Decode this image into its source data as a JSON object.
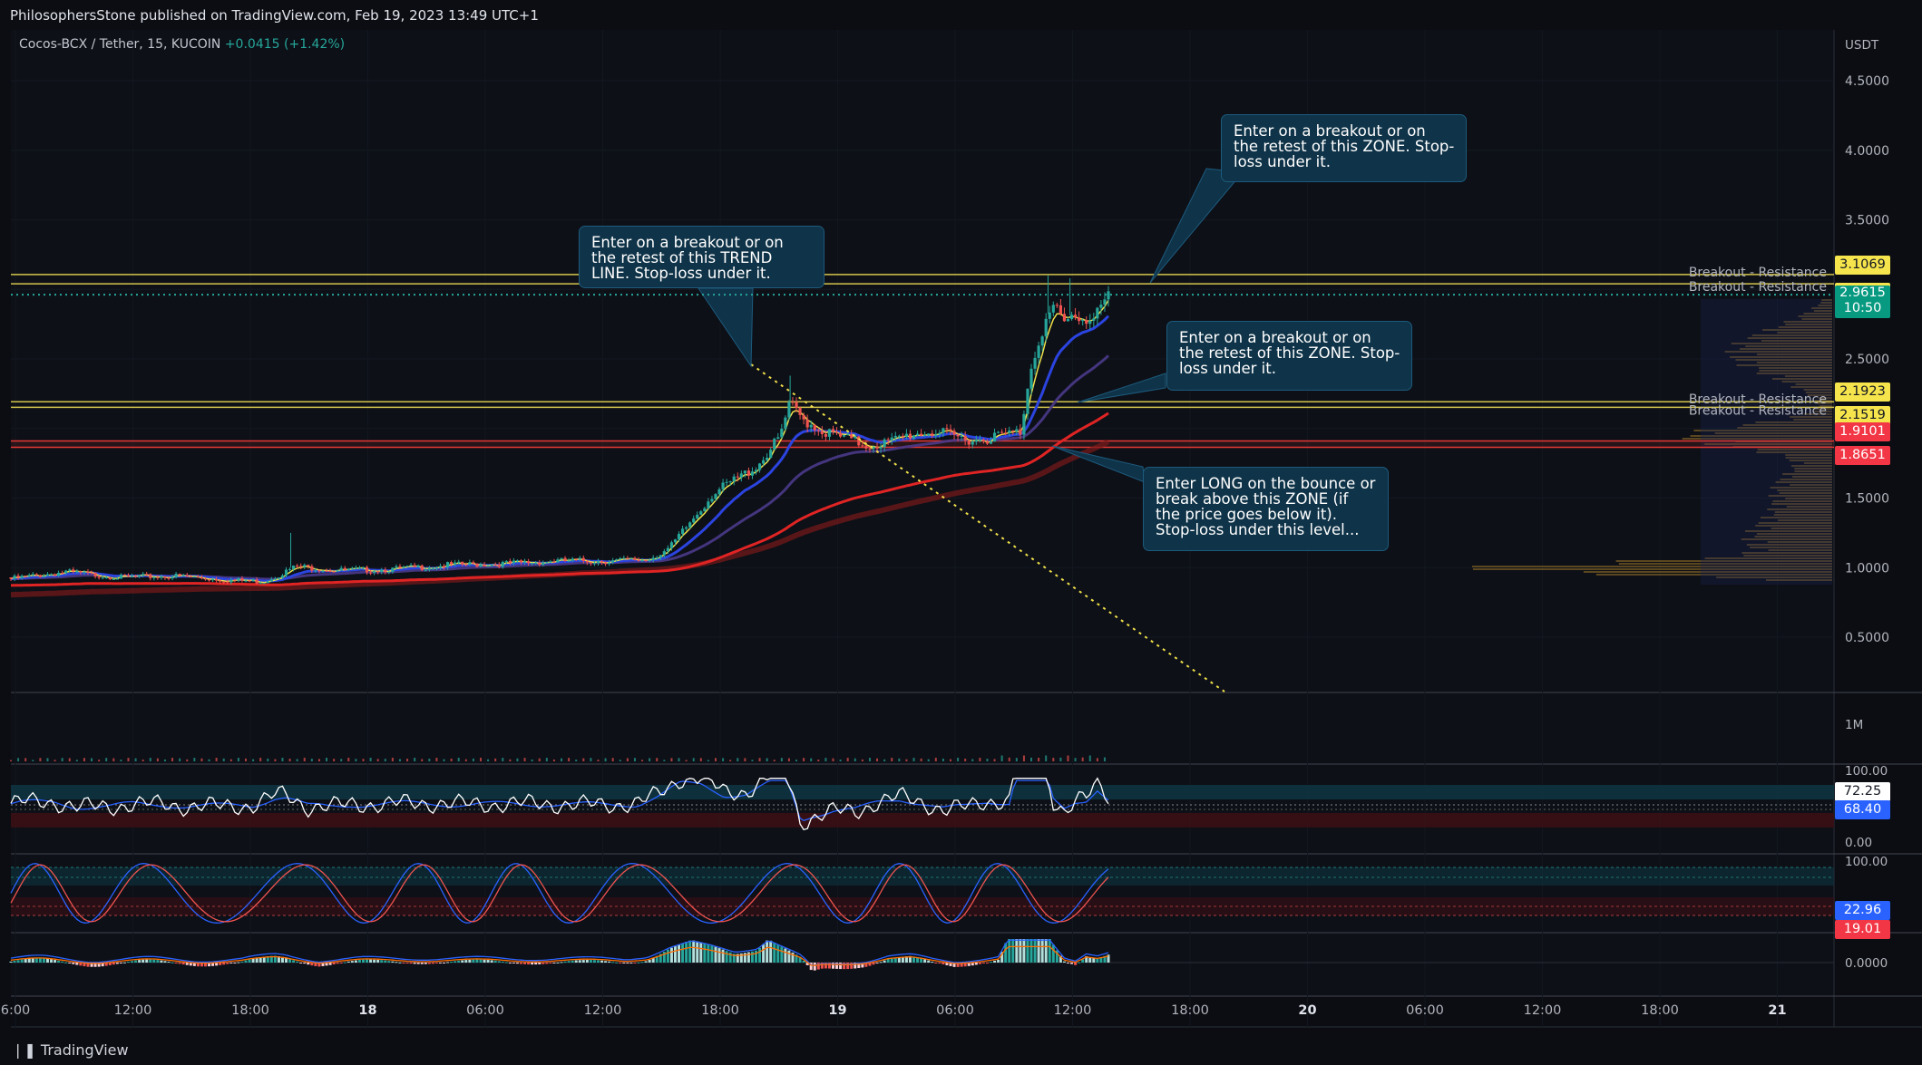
{
  "header": {
    "publisher_line": "PhilosophersStone published on TradingView.com, Feb 19, 2023 13:49 UTC+1"
  },
  "legend": {
    "symbol": "Cocos-BCX / Tether, 15, KUCOIN",
    "change": "+0.0415 (+1.42%)"
  },
  "footer": {
    "brand": "TradingView"
  },
  "colors": {
    "background": "#0b0d12",
    "resistance": "#d4c44c",
    "support_zone": "#e53935",
    "ema_fast": "#f0e04a",
    "ema_blue": "#2b44e0",
    "ema_purple": "#4a3a8a",
    "ema_red": "#e02424",
    "ema_dark_red": "#7a1a1a",
    "up": "#26a69a",
    "down": "#ef5350",
    "note_bg": "#0f3348"
  },
  "chart_data": {
    "type": "candlestick",
    "price_axis": {
      "unit_label": "USDT",
      "ticks": [
        "4.5000",
        "4.0000",
        "3.5000",
        "3.0000",
        "2.5000",
        "2.0000",
        "1.5000",
        "1.0000",
        "0.5000"
      ]
    },
    "time_axis": {
      "ticks": [
        "6:00",
        "12:00",
        "18:00",
        "18",
        "06:00",
        "12:00",
        "18:00",
        "19",
        "06:00",
        "12:00",
        "18:00",
        "20",
        "06:00",
        "12:00",
        "18:00",
        "21"
      ]
    },
    "horizontal_levels": [
      {
        "label": "Breakout - Resistance",
        "value": 3.1069,
        "tag": "3.1069",
        "color": "#d4c44c"
      },
      {
        "label": "Breakout - Resistance",
        "value": 3.0398,
        "tag": "3.0398",
        "color": "#d4c44c"
      },
      {
        "label": "Breakout - Resistance",
        "value": 2.1923,
        "tag": "2.1923",
        "color": "#d4c44c"
      },
      {
        "label": "Breakout - Resistance",
        "value": 2.1519,
        "tag": "2.1519",
        "color": "#d4c44c"
      },
      {
        "label": "",
        "value": 1.9101,
        "tag": "1.9101",
        "color": "#e53935"
      },
      {
        "label": "",
        "value": 1.8651,
        "tag": "1.8651",
        "color": "#e53935"
      }
    ],
    "last_price": {
      "value": 2.9615,
      "tag": "2.9615",
      "countdown": "10:50"
    },
    "price_path": [
      {
        "t": 0,
        "p": 0.93
      },
      {
        "t": 0.05,
        "p": 0.98
      },
      {
        "t": 0.1,
        "p": 0.94
      },
      {
        "t": 0.15,
        "p": 0.95
      },
      {
        "t": 0.2,
        "p": 0.92
      },
      {
        "t": 0.23,
        "p": 0.91
      },
      {
        "t": 0.25,
        "p": 0.98
      },
      {
        "t": 0.26,
        "p": 1.02
      },
      {
        "t": 0.3,
        "p": 0.99
      },
      {
        "t": 0.35,
        "p": 1.0
      },
      {
        "t": 0.4,
        "p": 1.03
      },
      {
        "t": 0.45,
        "p": 1.04
      },
      {
        "t": 0.5,
        "p": 1.06
      },
      {
        "t": 0.55,
        "p": 1.06
      },
      {
        "t": 0.58,
        "p": 1.07
      },
      {
        "t": 0.6,
        "p": 1.15
      },
      {
        "t": 0.62,
        "p": 1.35
      },
      {
        "t": 0.64,
        "p": 1.55
      },
      {
        "t": 0.66,
        "p": 1.65
      },
      {
        "t": 0.68,
        "p": 1.75
      },
      {
        "t": 0.7,
        "p": 1.95
      },
      {
        "t": 0.71,
        "p": 2.2
      },
      {
        "t": 0.72,
        "p": 2.1
      },
      {
        "t": 0.74,
        "p": 2.0
      },
      {
        "t": 0.76,
        "p": 1.95
      },
      {
        "t": 0.78,
        "p": 1.9
      },
      {
        "t": 0.8,
        "p": 1.92
      },
      {
        "t": 0.82,
        "p": 1.98
      },
      {
        "t": 0.84,
        "p": 2.0
      },
      {
        "t": 0.86,
        "p": 1.96
      },
      {
        "t": 0.88,
        "p": 1.94
      },
      {
        "t": 0.9,
        "p": 1.97
      },
      {
        "t": 0.92,
        "p": 2.0
      },
      {
        "t": 0.93,
        "p": 2.5
      },
      {
        "t": 0.94,
        "p": 2.75
      },
      {
        "t": 0.95,
        "p": 2.9
      },
      {
        "t": 0.96,
        "p": 2.78
      },
      {
        "t": 0.97,
        "p": 2.85
      },
      {
        "t": 0.98,
        "p": 2.8
      },
      {
        "t": 0.99,
        "p": 2.9
      },
      {
        "t": 1.0,
        "p": 2.9615
      }
    ],
    "volume_panel": {
      "label": "1M"
    },
    "rsi_panel": {
      "ticks": [
        "100.00",
        "0.00"
      ],
      "value_tags": [
        "72.25",
        "68.40"
      ]
    },
    "stoch_panel": {
      "ticks": [
        "100.00"
      ],
      "value_tags": [
        "22.96",
        "19.01"
      ]
    },
    "macd_panel": {
      "ticks": [
        "0.0000"
      ]
    }
  },
  "annotations": [
    {
      "id": "trendline-note",
      "text": "Enter on a breakout or on the retest of this TREND LINE. Stop-loss under it."
    },
    {
      "id": "top-zone-note",
      "text": "Enter on a breakout or on the retest of this ZONE. Stop-loss under it."
    },
    {
      "id": "mid-zone-note",
      "text": "Enter on a breakout or on the retest of this ZONE. Stop-loss under it."
    },
    {
      "id": "long-note",
      "text": "Enter LONG on the bounce or break above this ZONE (if the price goes below it). Stop-loss under this level..."
    }
  ]
}
